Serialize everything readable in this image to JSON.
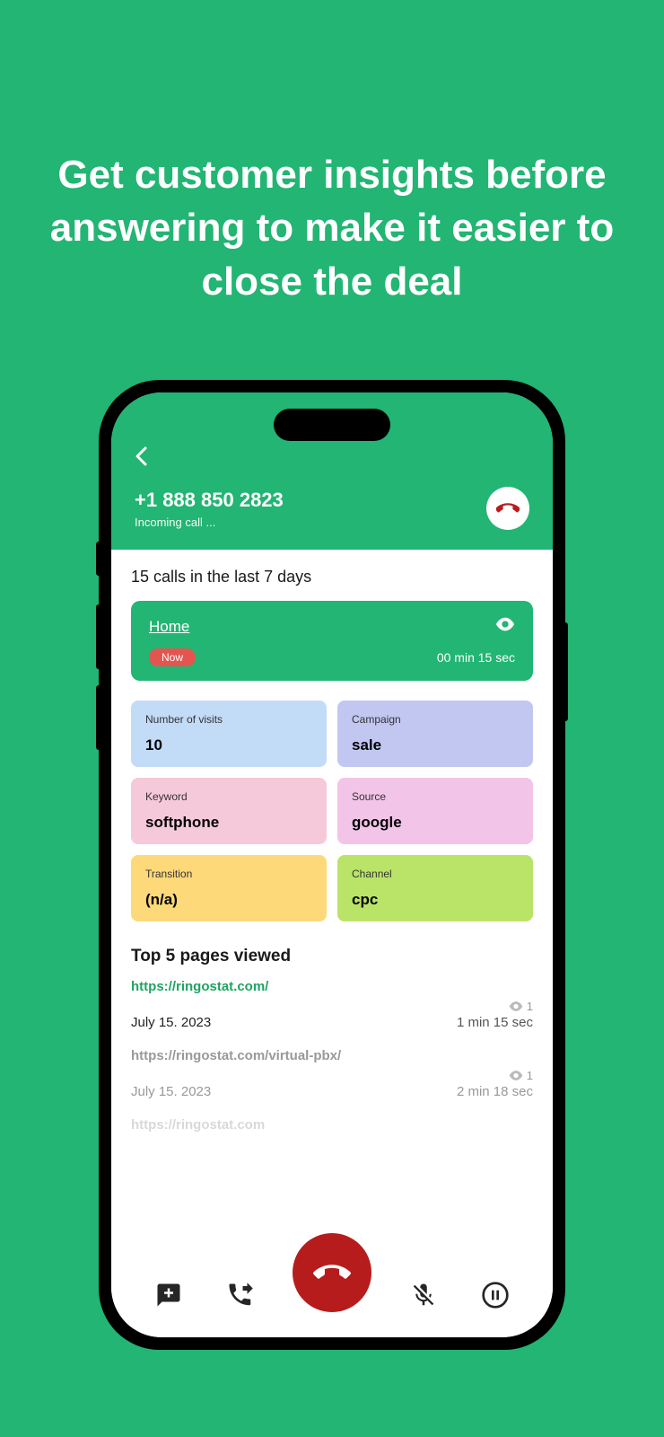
{
  "headline": "Get customer insights before answering to make it easier to close the deal",
  "header": {
    "phone_number": "+1 888 850 2823",
    "call_status": "Incoming call ..."
  },
  "summary": "15 calls in the last 7 days",
  "live": {
    "page": "Home",
    "badge": "Now",
    "duration": "00 min 15 sec"
  },
  "stats": [
    {
      "label": "Number of visits",
      "value": "10"
    },
    {
      "label": "Campaign",
      "value": "sale"
    },
    {
      "label": "Keyword",
      "value": "softphone"
    },
    {
      "label": "Source",
      "value": "google"
    },
    {
      "label": "Transition",
      "value": "(n/a)"
    },
    {
      "label": "Channel",
      "value": "cpc"
    }
  ],
  "top_pages_title": "Top 5 pages viewed",
  "pages": [
    {
      "url": "https://ringostat.com/",
      "date": "July 15. 2023",
      "views": "1",
      "duration": "1 min 15 sec"
    },
    {
      "url": "https://ringostat.com/virtual-pbx/",
      "date": "July 15. 2023",
      "views": "1",
      "duration": "2 min 18 sec"
    },
    {
      "url": "https://ringostat.com",
      "date": "",
      "views": "",
      "duration": ""
    }
  ]
}
